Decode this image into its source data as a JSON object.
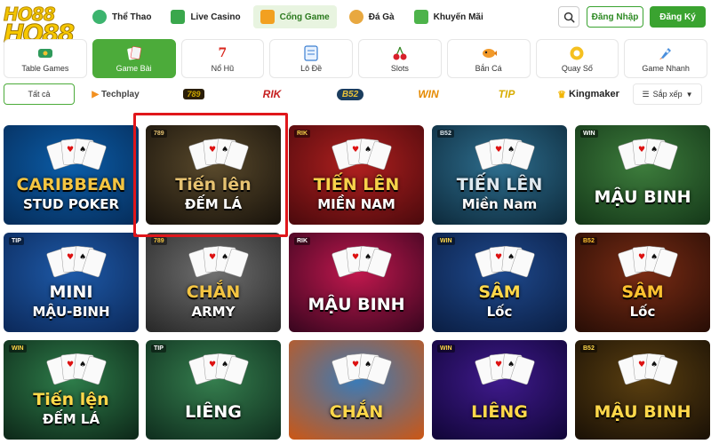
{
  "header": {
    "logo_top": "HO88",
    "logo_bottom": "HO88",
    "nav": [
      {
        "label": "Thể Thao",
        "icon": "sports-icon",
        "active": false
      },
      {
        "label": "Live Casino",
        "icon": "live-casino-icon",
        "active": false
      },
      {
        "label": "Cổng Game",
        "icon": "game-portal-icon",
        "active": true
      },
      {
        "label": "Đá Gà",
        "icon": "cockfight-icon",
        "active": false
      },
      {
        "label": "Khuyến Mãi",
        "icon": "gift-icon",
        "active": false
      }
    ],
    "login_label": "Đăng Nhập",
    "register_label": "Đăng Ký",
    "search_icon": "search-icon"
  },
  "categories": [
    {
      "label": "Table Games",
      "icon": "table-games-icon",
      "active": false
    },
    {
      "label": "Game Bài",
      "icon": "card-game-icon",
      "active": true
    },
    {
      "label": "Nổ Hũ",
      "icon": "lucky-seven-icon",
      "active": false
    },
    {
      "label": "Lô Đề",
      "icon": "lottery-icon",
      "active": false
    },
    {
      "label": "Slots",
      "icon": "cherry-icon",
      "active": false
    },
    {
      "label": "Bắn Cá",
      "icon": "fish-icon",
      "active": false
    },
    {
      "label": "Quay Số",
      "icon": "lottery-ball-icon",
      "active": false
    },
    {
      "label": "Game Nhanh",
      "icon": "rocket-icon",
      "active": false
    }
  ],
  "providers": {
    "all_label": "Tất cả",
    "items": [
      {
        "label": "Techplay",
        "icon": "techplay-icon",
        "color": "#444444"
      },
      {
        "label": "789",
        "icon": "club-badge-icon",
        "color": "#c9a400"
      },
      {
        "label": "RIK",
        "icon": "rik-icon",
        "color": "#c62020"
      },
      {
        "label": "B52",
        "icon": "b52-icon",
        "color": "#1b5e8e"
      },
      {
        "label": "WIN",
        "icon": "win-icon",
        "color": "#d88a00"
      },
      {
        "label": "TIP",
        "icon": "tip-icon",
        "color": "#c8a000"
      },
      {
        "label": "Kingmaker",
        "icon": "crown-icon",
        "color": "#222222"
      }
    ],
    "sort_label": "Sắp xếp"
  },
  "games": [
    {
      "line1": "CARIBBEAN",
      "line2": "STUD POKER",
      "bg1": "#0b5da8",
      "bg2": "#062e5c",
      "accent": "#f4c542",
      "badge": "",
      "selected": false
    },
    {
      "line1": "Tiến lên",
      "line2": "ĐẾM LÁ",
      "bg1": "#5a4a2c",
      "bg2": "#1a140c",
      "accent": "#e6c271",
      "badge": "789",
      "selected": true
    },
    {
      "line1": "TIẾN LÊN",
      "line2": "MIỀN NAM",
      "bg1": "#b0201f",
      "bg2": "#4e0a0d",
      "accent": "#f7d24a",
      "badge": "RIK",
      "selected": false
    },
    {
      "line1": "TIẾN LÊN",
      "line2": "Miền Nam",
      "bg1": "#2e6e8e",
      "bg2": "#0e2c3e",
      "accent": "#dfe9f0",
      "badge": "B52",
      "selected": false
    },
    {
      "line1": "MẬU BINH",
      "line2": "",
      "bg1": "#3d7d3c",
      "bg2": "#163a1a",
      "accent": "#ffffff",
      "badge": "WIN",
      "selected": false
    },
    {
      "line1": "MINI",
      "line2": "MẬU-BINH",
      "bg1": "#1e5aa8",
      "bg2": "#0c2a5c",
      "accent": "#ffffff",
      "badge": "TIP",
      "selected": false
    },
    {
      "line1": "CHẮN",
      "line2": "ARMY",
      "bg1": "#707070",
      "bg2": "#2a2a2a",
      "accent": "#f4c542",
      "badge": "789",
      "selected": false
    },
    {
      "line1": "MẬU BINH",
      "line2": "",
      "bg1": "#c1184e",
      "bg2": "#3c0620",
      "accent": "#ffffff",
      "badge": "RIK",
      "selected": false
    },
    {
      "line1": "SÂM",
      "line2": "Lốc",
      "bg1": "#1f4a8e",
      "bg2": "#0b1f45",
      "accent": "#ffd84a",
      "badge": "WIN",
      "selected": false
    },
    {
      "line1": "SÂM",
      "line2": "Lốc",
      "bg1": "#7a2c14",
      "bg2": "#2a0e06",
      "accent": "#ffc230",
      "badge": "B52",
      "selected": false
    },
    {
      "line1": "Tiến lện",
      "line2": "ĐẾM LÁ",
      "bg1": "#2e7d4a",
      "bg2": "#0e2a1a",
      "accent": "#ffd84a",
      "badge": "WIN",
      "selected": false
    },
    {
      "line1": "LIÊNG",
      "line2": "",
      "bg1": "#357e4e",
      "bg2": "#10301f",
      "accent": "#ffffff",
      "badge": "TIP",
      "selected": false
    },
    {
      "line1": "CHẮN",
      "line2": "",
      "bg1": "#3a7bb8",
      "bg2": "#c7581a",
      "accent": "#ffd84a",
      "badge": "",
      "selected": false
    },
    {
      "line1": "LIÊNG",
      "line2": "",
      "bg1": "#3f1a8c",
      "bg2": "#12063a",
      "accent": "#ffd84a",
      "badge": "WIN",
      "selected": false
    },
    {
      "line1": "MẬU BINH",
      "line2": "",
      "bg1": "#5a3f10",
      "bg2": "#1c1206",
      "accent": "#ffd84a",
      "badge": "B52",
      "selected": false
    }
  ]
}
